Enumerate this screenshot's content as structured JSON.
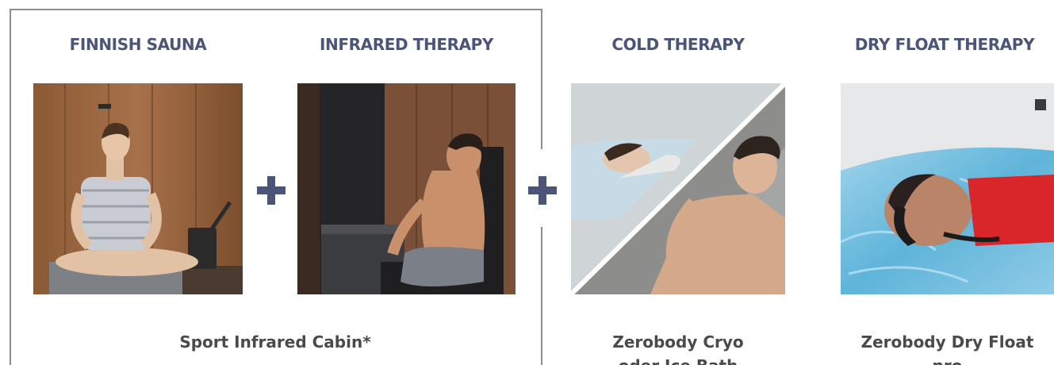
{
  "colors": {
    "heading": "#4a5578",
    "plus": "#4a5578",
    "caption": "#4a4a4a",
    "group_border": "#8e8e8e"
  },
  "products": [
    {
      "title": "FINNISH SAUNA",
      "image": "woman-in-towel-sitting-in-finnish-sauna"
    },
    {
      "title": "INFRARED THERAPY",
      "image": "man-relaxing-in-infrared-cabin"
    },
    {
      "title": "COLD THERAPY",
      "image": "woman-in-cryo-chamber-and-man-in-ice-bath"
    },
    {
      "title": "DRY FLOAT THERAPY",
      "image": "man-lying-on-dry-float-bed"
    }
  ],
  "icons": {
    "plus_1": "plus-icon",
    "plus_2": "plus-icon"
  },
  "captions": {
    "group": "Sport Infrared Cabin*",
    "cold_line1": "Zerobody Cryo",
    "cold_line2": "oder Ice Bath",
    "float_line1": "Zerobody Dry Float",
    "float_line2": "pro"
  }
}
